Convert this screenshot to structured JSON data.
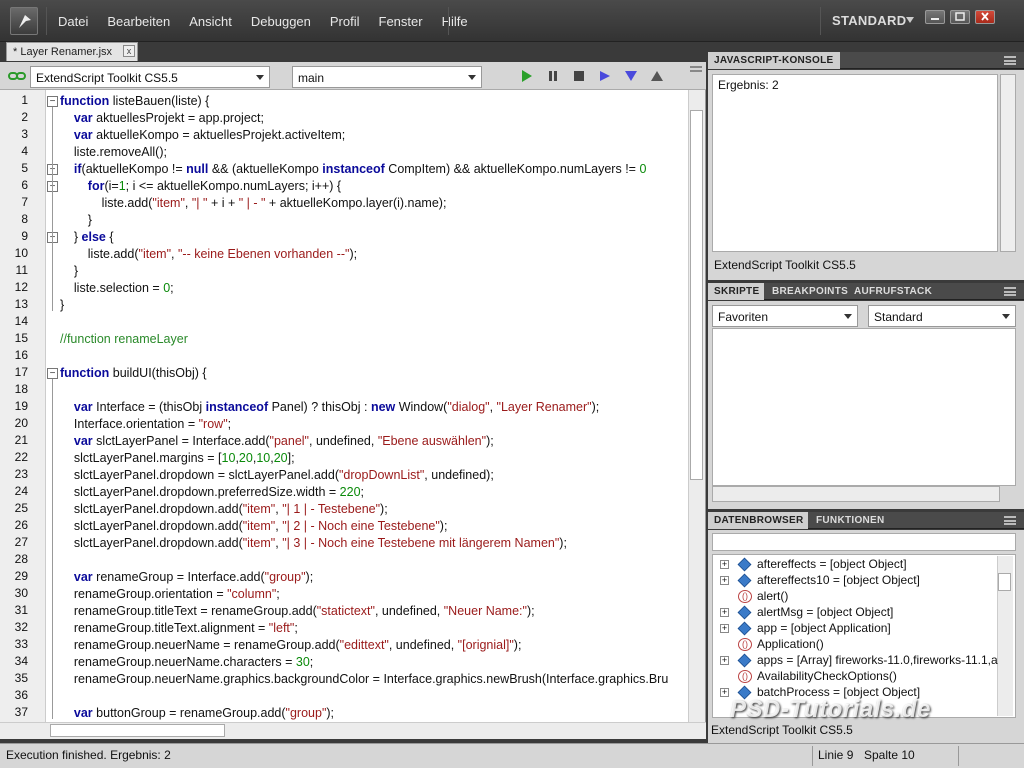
{
  "menu": [
    "Datei",
    "Bearbeiten",
    "Ansicht",
    "Debuggen",
    "Profil",
    "Fenster",
    "Hilfe"
  ],
  "workspace": "STANDARD",
  "document_tab": "* Layer Renamer.jsx",
  "document_tab_close": "x",
  "toolbar": {
    "target": "ExtendScript Toolkit CS5.5",
    "engine": "main"
  },
  "code_lines": [
    "function listeBauen(liste) {",
    "    var aktuellesProjekt = app.project;",
    "    var aktuelleKompo = aktuellesProjekt.activeItem;",
    "    liste.removeAll();",
    "    if(aktuelleKompo != null && (aktuelleKompo instanceof CompItem) && aktuelleKompo.numLayers != 0",
    "        for(i=1; i <= aktuelleKompo.numLayers; i++) {",
    "            liste.add(\"item\", \"| \" + i + \" | - \" + aktuelleKompo.layer(i).name);",
    "        }",
    "    } else {",
    "        liste.add(\"item\", \"-- keine Ebenen vorhanden --\");",
    "    }",
    "    liste.selection = 0;",
    "}",
    "",
    "//function renameLayer",
    "",
    "function buildUI(thisObj) {",
    "",
    "    var Interface = (thisObj instanceof Panel) ? thisObj : new Window(\"dialog\", \"Layer Renamer\");",
    "    Interface.orientation = \"row\";",
    "    var slctLayerPanel = Interface.add(\"panel\", undefined, \"Ebene auswählen\");",
    "    slctLayerPanel.margins = [10,20,10,20];",
    "    slctLayerPanel.dropdown = slctLayerPanel.add(\"dropDownList\", undefined);",
    "    slctLayerPanel.dropdown.preferredSize.width = 220;",
    "    slctLayerPanel.dropdown.add(\"item\", \"| 1 | - Testebene\");",
    "    slctLayerPanel.dropdown.add(\"item\", \"| 2 | - Noch eine Testebene\");",
    "    slctLayerPanel.dropdown.add(\"item\", \"| 3 | - Noch eine Testebene mit längerem Namen\");",
    "",
    "    var renameGroup = Interface.add(\"group\");",
    "    renameGroup.orientation = \"column\";",
    "    renameGroup.titleText = renameGroup.add(\"statictext\", undefined, \"Neuer Name:\");",
    "    renameGroup.titleText.alignment = \"left\";",
    "    renameGroup.neuerName = renameGroup.add(\"edittext\", undefined, \"[orignial]\");",
    "    renameGroup.neuerName.characters = 30;",
    "    renameGroup.neuerName.graphics.backgroundColor = Interface.graphics.newBrush(Interface.graphics.Bru",
    "",
    "    var buttonGroup = renameGroup.add(\"group\");"
  ],
  "console": {
    "tab": "JAVASCRIPT-KONSOLE",
    "output": "Ergebnis: 2",
    "footer": "ExtendScript Toolkit CS5.5"
  },
  "scripts_panel": {
    "tabs": [
      "SKRIPTE",
      "BREAKPOINTS",
      "AUFRUFSTACK"
    ],
    "dd1": "Favoriten",
    "dd2": "Standard"
  },
  "data_browser": {
    "tabs": [
      "DATENBROWSER",
      "FUNKTIONEN"
    ],
    "items": [
      {
        "text": "aftereffects = [object Object]",
        "icon": "object-icon",
        "plus": true
      },
      {
        "text": "aftereffects10 = [object Object]",
        "icon": "object-icon",
        "plus": true
      },
      {
        "text": "alert()",
        "icon": "function-icon",
        "plus": false
      },
      {
        "text": "alertMsg = [object Object]",
        "icon": "object-icon",
        "plus": true
      },
      {
        "text": "app = [object Application]",
        "icon": "object-icon",
        "plus": true
      },
      {
        "text": "Application()",
        "icon": "function-icon",
        "plus": false
      },
      {
        "text": "apps = [Array] fireworks-11.0,fireworks-11.1,a",
        "icon": "object-icon",
        "plus": true
      },
      {
        "text": "AvailabilityCheckOptions()",
        "icon": "function-icon",
        "plus": false
      },
      {
        "text": "batchProcess = [object Object]",
        "icon": "object-icon",
        "plus": true
      }
    ],
    "footer": "ExtendScript Toolkit CS5.5"
  },
  "status": {
    "message": "Execution finished. Ergebnis: 2",
    "line": "Linie 9",
    "column": "Spalte 10"
  },
  "watermark": "PSD-Tutorials.de",
  "colors": {
    "keyword": "#0a0a9a",
    "string": "#9a1a1a",
    "number": "#0a8a0a",
    "comment": "#2a8a2a"
  }
}
